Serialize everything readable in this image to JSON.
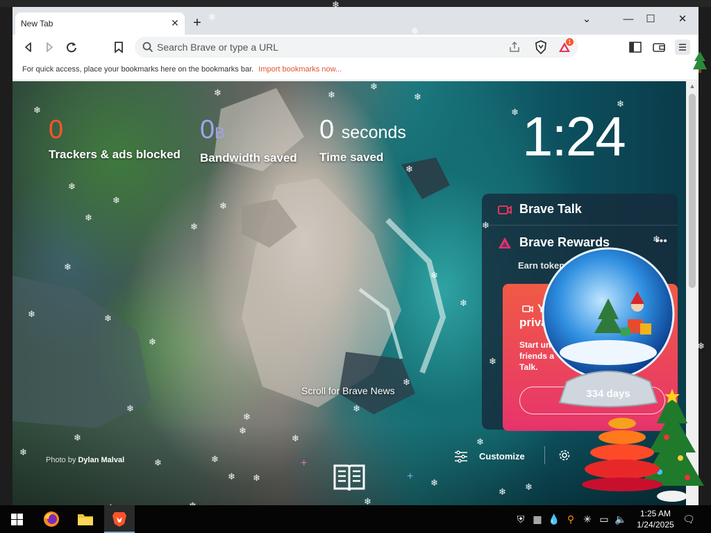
{
  "window": {
    "tab_title": "New Tab",
    "tab_close": "✕",
    "new_tab": "+",
    "controls": {
      "dropdown": "⌄",
      "minimize": "—",
      "maximize": "☐",
      "close": "✕"
    }
  },
  "toolbar": {
    "url_placeholder": "Search Brave or type a URL",
    "rewards_badge": "1"
  },
  "bookmarks_bar": {
    "message": "For quick access, place your bookmarks here on the bookmarks bar.",
    "import_link": "Import bookmarks now..."
  },
  "stats": [
    {
      "value": "0",
      "unit": "",
      "label": "Trackers & ads blocked",
      "color": "#fb542b"
    },
    {
      "value": "0",
      "unit": "B",
      "label": "Bandwidth saved",
      "color": "#a0a5eb"
    },
    {
      "value": "0",
      "unit": "seconds",
      "label": "Time saved",
      "color": "#ffffff"
    }
  ],
  "clock": "1:24",
  "widgets": {
    "talk_title": "Brave Talk",
    "rewards_title": "Brave Rewards",
    "rewards_sub": "Earn tokens and",
    "promo_title": "You privat",
    "promo_body": "Start un friends a Talk.",
    "globe_days": "334 days"
  },
  "scroll_news": "Scroll for Brave News",
  "photo_credit": {
    "prefix": "Photo by",
    "author": "Dylan Malval"
  },
  "customize_label": "Customize",
  "taskbar": {
    "time": "1:25 AM",
    "date": "1/24/2025"
  },
  "colors": {
    "brave_orange": "#fb542b",
    "accent_purple": "#a0a5eb",
    "promo_red": "#f05a45"
  }
}
